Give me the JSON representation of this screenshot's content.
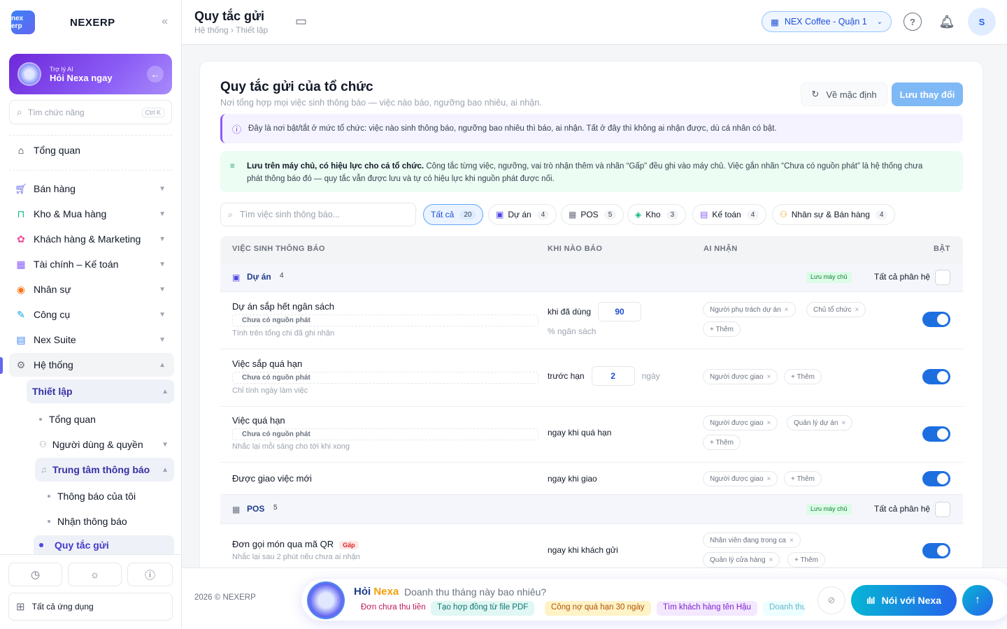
{
  "brand": {
    "logo": "nex erp",
    "name": "NEXERP"
  },
  "ai_card": {
    "small": "Trợ lý AI",
    "big": "Hỏi Nexa ngay"
  },
  "side_search": {
    "placeholder": "Tìm chức năng",
    "shortcut": "Ctrl K"
  },
  "nav": {
    "overview": "Tổng quan",
    "sales": "Bán hàng",
    "stock": "Kho & Mua hàng",
    "crm": "Khách hàng & Marketing",
    "finance": "Tài chính – Kế toán",
    "hr": "Nhân sự",
    "tools": "Công cụ",
    "suite": "Nex Suite",
    "system": "Hệ thống",
    "setup": "Thiết lập",
    "setup_overview": "Tổng quan",
    "users": "Người dùng & quyền",
    "notif_center": "Trung tâm thông báo",
    "my_notif": "Thông báo của tôi",
    "receive_notif": "Nhận thông báo",
    "send_rules": "Quy tắc gửi"
  },
  "all_apps": "Tất cả ứng dụng",
  "topbar": {
    "title": "Quy tắc gửi",
    "breadcrumb": "Hệ thống › Thiết lập",
    "branch": "NEX Coffee - Quận 1",
    "avatar": "S"
  },
  "header": {
    "title": "Quy tắc gửi của tổ chức",
    "subtitle": "Nơi tổng hợp mọi việc sinh thông báo — việc nào báo, ngưỡng bao nhiêu, ai nhận.",
    "reset": "Về mặc định",
    "save": "Lưu thay đổi"
  },
  "info1": "Đây là nơi bật/tắt ở mức tổ chức: việc nào sinh thông báo, ngưỡng bao nhiêu thì báo, ai nhận. Tất ở đây thì không ai nhận được, dù cá nhân có bật.",
  "info2": {
    "bold": "Lưu trên máy chủ, có hiệu lực cho cả tổ chức.",
    "line1": " Công tắc từng việc, ngưỡng, vai trò nhận thêm và nhãn “Gấp” đều ghi vào máy chủ. Việc gắn nhãn “Chưa có nguồn phát” là hệ thống chưa",
    "line2": "phát thông báo đó — quy tắc vẫn được lưu và tự có hiệu lực khi nguồn phát được nối."
  },
  "filter": {
    "placeholder": "Tìm việc sinh thông báo...",
    "chips": [
      {
        "label": "Tất cả",
        "count": "20"
      },
      {
        "label": "Dự án",
        "count": "4"
      },
      {
        "label": "POS",
        "count": "5"
      },
      {
        "label": "Kho",
        "count": "3"
      },
      {
        "label": "Kế toán",
        "count": "4"
      },
      {
        "label": "Nhân sự & Bán hàng",
        "count": "4"
      }
    ]
  },
  "table": {
    "headers": [
      "VIỆC SINH THÔNG BÁO",
      "KHI NÀO BÁO",
      "AI NHẬN",
      "BẬT"
    ]
  },
  "groups": {
    "project": {
      "name": "Dự án",
      "count": "4",
      "server": "Lưu máy chủ",
      "all": "Tất cả phân hệ"
    },
    "pos": {
      "name": "POS",
      "count": "5",
      "server": "Lưu máy chủ",
      "all": "Tất cả phân hệ"
    }
  },
  "rows": [
    {
      "title": "Dự án sắp hết ngân sách",
      "tag": "Chưa có nguồn phát",
      "note": "Tính trên tổng chi đã ghi nhận",
      "when_pre": "khi đã dùng",
      "value": "90",
      "when_sub": "% ngân sách",
      "recipients": [
        "Người phụ trách dự án",
        "Chủ tổ chức"
      ],
      "add": "+ Thêm",
      "enabled": true
    },
    {
      "title": "Việc sắp quá hạn",
      "tag": "Chưa có nguồn phát",
      "note": "Chỉ tính ngày làm việc",
      "when_pre": "trước hạn",
      "value": "2",
      "when_unit": "ngày",
      "recipients": [
        "Người được giao"
      ],
      "add": "+ Thêm",
      "enabled": true
    },
    {
      "title": "Việc quá hạn",
      "tag": "Chưa có nguồn phát",
      "note": "Nhắc lại mỗi sáng cho tới khi xong",
      "when_pre": "ngay khi quá hạn",
      "recipients": [
        "Người được giao",
        "Quản lý dự án"
      ],
      "add": "+ Thêm",
      "enabled": true
    },
    {
      "title": "Được giao việc mới",
      "when_pre": "ngay khi giao",
      "recipients": [
        "Người được giao"
      ],
      "add": "+ Thêm",
      "enabled": true
    },
    {
      "title": "Đơn gọi món qua mã QR",
      "urgent": "Gấp",
      "note": "Nhắc lại sau 2 phút nếu chưa ai nhận",
      "when_pre": "ngay khi khách gửi",
      "recipients": [
        "Nhân viên đang trong ca",
        "Quản lý cửa hàng"
      ],
      "add": "+ Thêm",
      "enabled": true
    }
  ],
  "footer": {
    "copyright": "2026 © NEXERP",
    "ask_hoi": "Hỏi",
    "ask_nexa": "Nexa",
    "question": "Doanh thu tháng này bao nhiêu?",
    "suggestions": [
      "Đơn chưa thu tiền",
      "Tạo hợp đồng từ file PDF",
      "Công nợ quá hạn 30 ngày",
      "Tìm khách hàng tên Hậu",
      "Doanh thu"
    ],
    "talk": "Nói với Nexa"
  },
  "colors": {
    "accent": "#1d6fe0",
    "ai_purple": "#7c3aed"
  }
}
